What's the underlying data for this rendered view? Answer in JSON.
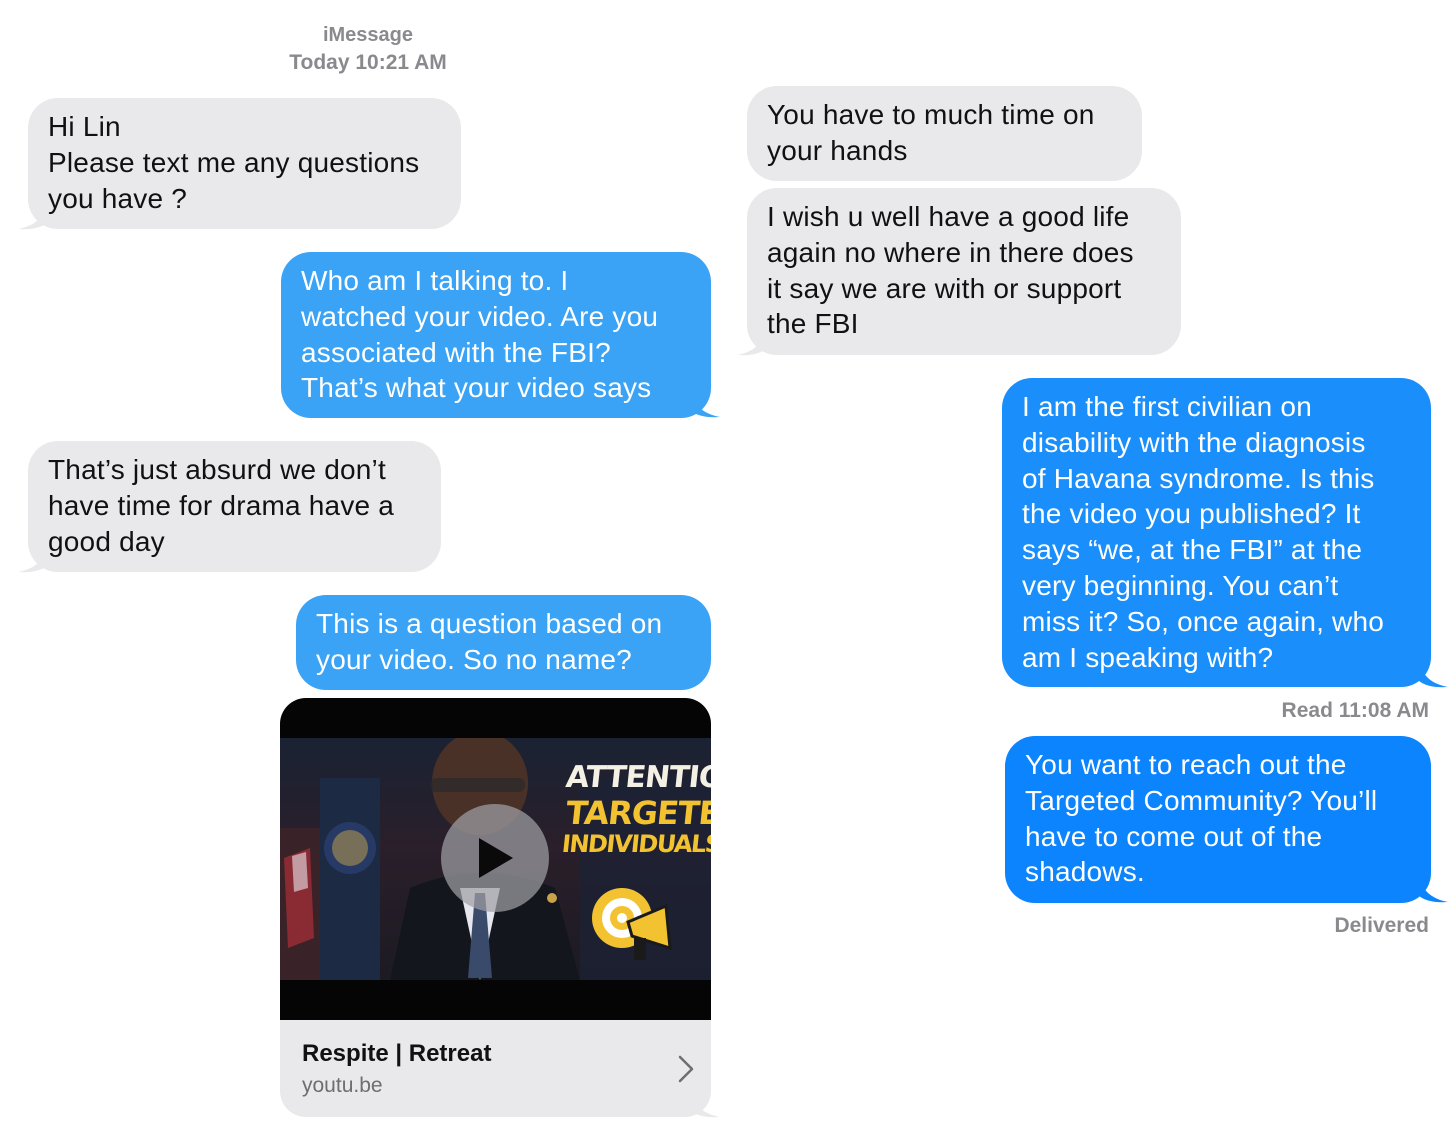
{
  "header": {
    "service": "iMessage",
    "timestamp": "Today 10:21 AM"
  },
  "left_column": {
    "messages": [
      {
        "direction": "incoming",
        "lines": [
          "Hi Lin",
          "Please text me any questions",
          "you have ?"
        ]
      },
      {
        "direction": "outgoing",
        "lines": [
          "Who am I talking to. I",
          "watched your video. Are you",
          "associated with the FBI?",
          "That’s what your video says"
        ]
      },
      {
        "direction": "incoming",
        "lines": [
          "That’s just absurd we don’t",
          "have time for drama have a",
          "good day"
        ]
      },
      {
        "direction": "outgoing",
        "lines": [
          "This is a question based on",
          "your video. So no name?"
        ]
      }
    ],
    "link_preview": {
      "title": "Respite | Retreat",
      "domain": "youtu.be",
      "thumbnail_text": [
        "ATTENTION",
        "TARGETED",
        "INDIVIDUALS"
      ],
      "icon": "play-icon"
    }
  },
  "right_column": {
    "messages": [
      {
        "direction": "incoming",
        "lines": [
          "You have to much time on",
          "your hands"
        ]
      },
      {
        "direction": "incoming",
        "lines": [
          "I wish u well have a good life",
          "again no where in there does",
          "it say we are with or support",
          "the FBI"
        ]
      },
      {
        "direction": "outgoing",
        "lines": [
          "I am the first civilian on",
          "disability with the diagnosis",
          "of Havana syndrome. Is this",
          "the video you published? It",
          "says “we, at the FBI” at the",
          "very beginning. You can’t",
          "miss it? So, once again, who",
          "am I speaking with?"
        ]
      },
      {
        "direction": "outgoing",
        "lines": [
          "You want to reach out the",
          "Targeted Community? You’ll",
          "have to come out of the",
          "shadows."
        ]
      }
    ],
    "read_receipt": "Read 11:08 AM",
    "delivered_status": "Delivered"
  },
  "colors": {
    "incoming_bubble": "#e9e9eb",
    "outgoing_bubble_light": "#3aa3f5",
    "outgoing_bubble_deep": "#0b84fe",
    "meta_text": "#8a8a8e",
    "thumbnail_accent": "#f2c230"
  }
}
